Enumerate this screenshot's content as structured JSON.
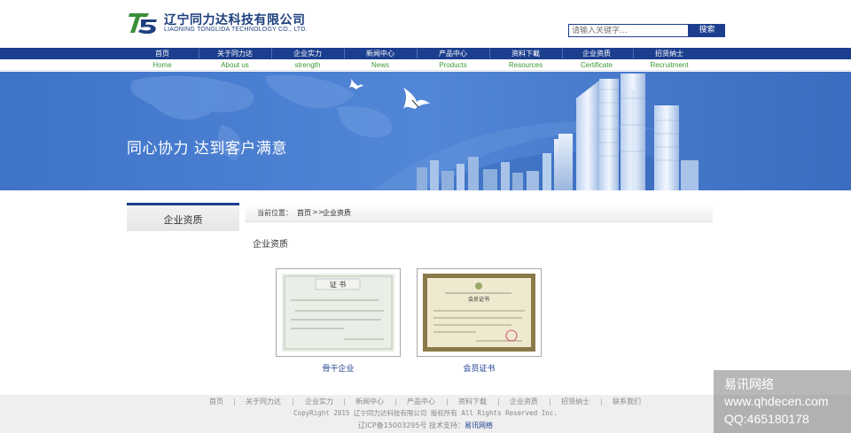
{
  "header": {
    "company_cn": "辽宁同力达科技有限公司",
    "company_en": "LIAONING TONGLIDA TECHNOLOGY CO., LTD."
  },
  "search": {
    "placeholder": "请输入关键字...",
    "button_label": "搜索"
  },
  "nav": [
    {
      "cn": "首页",
      "en": "Home"
    },
    {
      "cn": "关于同力达",
      "en": "About us"
    },
    {
      "cn": "企业实力",
      "en": "strength"
    },
    {
      "cn": "新闻中心",
      "en": "News"
    },
    {
      "cn": "产品中心",
      "en": "Products"
    },
    {
      "cn": "资料下載",
      "en": "Resources"
    },
    {
      "cn": "企业资质",
      "en": "Certificate"
    },
    {
      "cn": "招贤纳士",
      "en": "Recruitment"
    }
  ],
  "banner": {
    "slogan": "同心协力 达到客户满意"
  },
  "sidebar": {
    "title": "企业资质"
  },
  "breadcrumb": {
    "prefix": "当前位置：",
    "home": "首页",
    "separator": ">>",
    "current": "企业资质"
  },
  "main": {
    "title": "企业资质",
    "certificates": [
      {
        "caption": "骨干企业",
        "stamp": "证 书"
      },
      {
        "caption": "会员证书",
        "stamp": "会员证书"
      }
    ]
  },
  "footer": {
    "links": [
      "首页",
      "关于同力达",
      "企业实力",
      "新闻中心",
      "产品中心",
      "资料下载",
      "企业资质",
      "招贤纳士",
      "联系我们"
    ],
    "copyright": "CopyRight 2015 辽宁同力达科技有限公司  版权所有 All Rights Reserved Inc.",
    "icp_text": "辽ICP备15003295号  技术支持：",
    "support": "易讯网络"
  },
  "watermark": {
    "line1": "易讯网络",
    "line2": "www.qhdecen.com",
    "line3": "QQ:465180178"
  },
  "colors": {
    "brand_blue": "#1b3e8e",
    "nav_green": "#3c9a34",
    "banner_blue": "#3c6fc4",
    "footer_bg": "#efefef"
  }
}
